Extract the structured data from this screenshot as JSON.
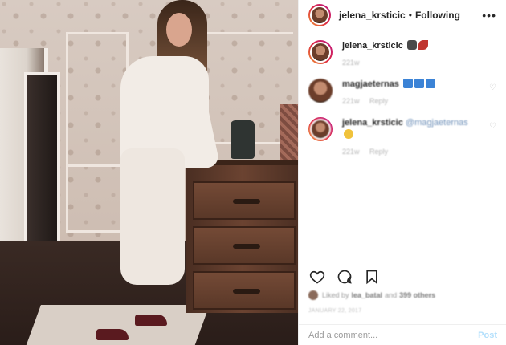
{
  "post_header": {
    "username": "jelena_krsticic",
    "separator": "•",
    "follow_label": "Following",
    "more_label": "•••"
  },
  "comments": [
    {
      "username": "jelena_krsticic",
      "text": "",
      "emojis": [
        "camera-emoji",
        "leaf-emoji"
      ],
      "age": "221w",
      "reply": ""
    },
    {
      "username": "magjaeternas",
      "text": "",
      "emojis": [
        "blue-square-emoji",
        "blue-square-emoji",
        "blue-square-emoji"
      ],
      "age": "221w",
      "reply": "Reply"
    },
    {
      "username": "jelena_krsticic",
      "mention": "@magjaeternas",
      "emojis": [
        "face-emoji"
      ],
      "age": "221w",
      "reply": "Reply"
    }
  ],
  "likes": {
    "prefix": "Liked by",
    "user": "lea_batal",
    "connector": "and",
    "others": "399 others"
  },
  "date": "JANUARY 22, 2017",
  "add_comment": {
    "placeholder": "Add a comment...",
    "post_label": "Post"
  },
  "colors": {
    "text": "#262626",
    "muted": "#9a9a9a",
    "post_disabled": "#b2dffc",
    "mention": "#6d8fb8"
  }
}
